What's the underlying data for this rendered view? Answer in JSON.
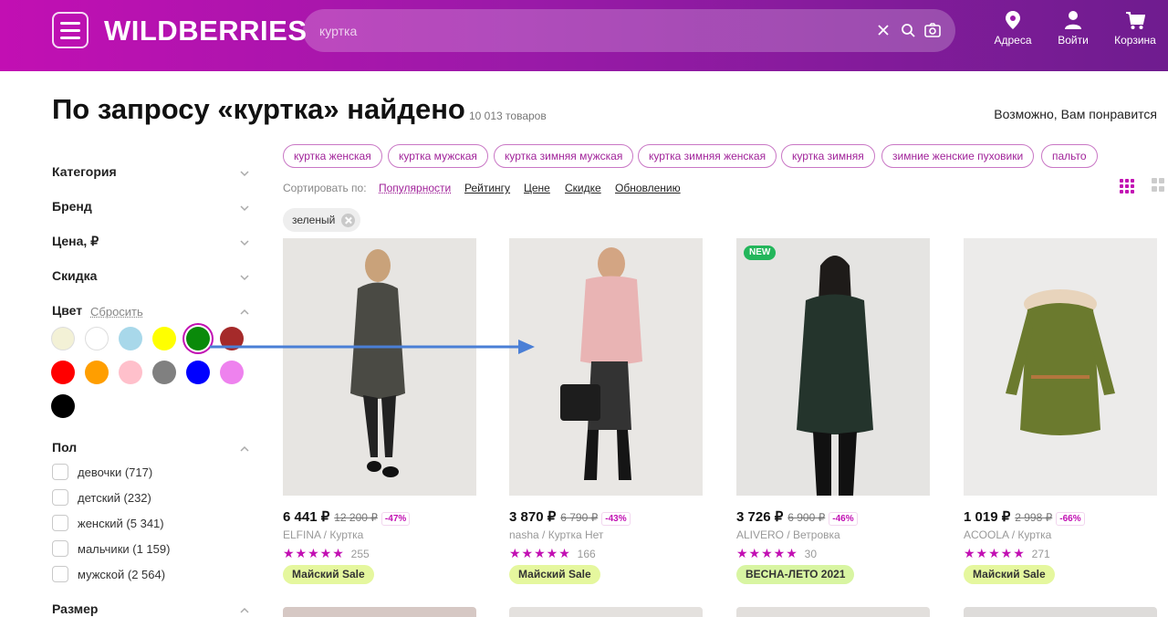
{
  "header": {
    "logo": "WILDBERRIES",
    "search_query": "куртка",
    "addresses": "Адреса",
    "login": "Войти",
    "cart": "Корзина",
    "gradient_start": "#c20fb3",
    "gradient_end": "#6f1c8f"
  },
  "page": {
    "title": "По запросу «куртка» найдено",
    "count": "10 013 товаров",
    "maybe_like": "Возможно, Вам понравится"
  },
  "filters": {
    "category": "Категория",
    "brand": "Бренд",
    "price": "Цена, ₽",
    "discount": "Скидка",
    "color": "Цвет",
    "reset": "Сбросить",
    "gender": "Пол",
    "size": "Размер",
    "colors": [
      "#f3f1d6",
      "#ffffff",
      "#a8d8ea",
      "#ffff00",
      "#0a8a0a",
      "#a52a2a",
      "#ff0000",
      "#ff9e00",
      "#ffc0cb",
      "#808080",
      "#0000ff",
      "#ee82ee",
      "#000000"
    ],
    "selected_color": "#0a8a0a",
    "gender_options": [
      "девочки (717)",
      "детский (232)",
      "женский (5 341)",
      "мальчики (1 159)",
      "мужской (2 564)"
    ]
  },
  "suggestions": [
    "куртка женская",
    "куртка мужская",
    "куртка зимняя мужская",
    "куртка зимняя женская",
    "куртка зимняя",
    "зимние женские пуховики",
    "пальто"
  ],
  "sort": {
    "label": "Сортировать по:",
    "options": [
      "Популярности",
      "Рейтингу",
      "Цене",
      "Скидке",
      "Обновлению"
    ],
    "active": "Популярности"
  },
  "active_tag": "зеленый",
  "products": [
    {
      "price": "6 441 ₽",
      "old": "12 200 ₽",
      "discount": "-47%",
      "brand": "ELFINA / Куртка",
      "stars": "★★★★★",
      "reviews": "255",
      "promo": "Майский Sale",
      "badge": ""
    },
    {
      "price": "3 870 ₽",
      "old": "6 790 ₽",
      "discount": "-43%",
      "brand": "nasha / Куртка Нет",
      "stars": "★★★★★",
      "reviews": "166",
      "promo": "Майский Sale",
      "badge": ""
    },
    {
      "price": "3 726 ₽",
      "old": "6 900 ₽",
      "discount": "-46%",
      "brand": "ALIVERO / Ветровка",
      "stars": "★★★★★",
      "reviews": "30",
      "promo": "ВЕСНА-ЛЕТО 2021",
      "badge": "NEW"
    },
    {
      "price": "1 019 ₽",
      "old": "2 998 ₽",
      "discount": "-66%",
      "brand": "ACOOLA / Куртка",
      "stars": "★★★★★",
      "reviews": "271",
      "promo": "Майский Sale",
      "badge": ""
    }
  ]
}
